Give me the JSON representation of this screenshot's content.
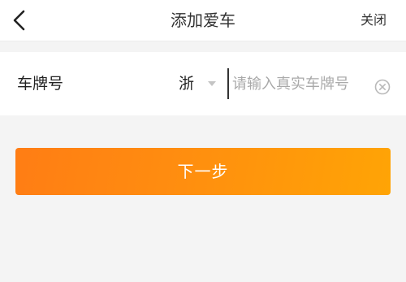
{
  "header": {
    "title": "添加爱车",
    "close_label": "关闭",
    "back_icon": "chevron-left-icon"
  },
  "plate_row": {
    "label": "车牌号",
    "province_value": "浙",
    "dropdown_icon": "caret-down-icon",
    "input_value": "",
    "input_placeholder": "请输入真实车牌号",
    "clear_icon": "clear-circle-icon"
  },
  "actions": {
    "next_label": "下一步",
    "next_gradient_start": "#ff7d14",
    "next_gradient_end": "#ffa405"
  }
}
